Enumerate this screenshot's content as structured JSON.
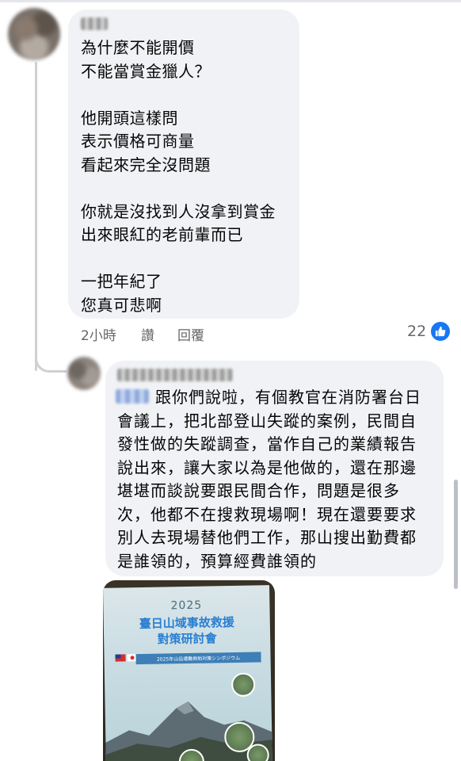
{
  "comment1": {
    "lines": [
      "為什麼不能開價",
      "不能當賞金獵人？",
      "",
      "他開頭這樣問",
      "表示價格可商量",
      "看起來完全沒問題",
      "",
      "你就是沒找到人沒拿到賞金",
      "出來眼紅的老前輩而已",
      "",
      "一把年紀了",
      "您真可悲啊"
    ],
    "time": "2小時",
    "like_label": "讚",
    "reply_label": "回覆",
    "reaction_count": "22",
    "reaction_icon": "thumbs-up-icon"
  },
  "comment2": {
    "lines": [
      "跟你們說啦，有個教官在消防署台日",
      "會議上，把北部登山失蹤的案例，民間自",
      "發性做的失蹤調查，當作自己的業績報告",
      "說出來，讓大家以為是他做的，還在那邊",
      "堪堪而談說要跟民間合作，問題是很多",
      "次，他都不在搜救現場啊！現在還要要求",
      "別人去現場替他們工作，那山搜出勤費都",
      "是誰領的，預算經費誰領的"
    ],
    "photo": {
      "year": "2025",
      "title_line1": "臺日山域事故救援",
      "title_line2": "對策研討會",
      "subtitle": "2025年山岳遭難救助対策シンポジウム"
    }
  },
  "colors": {
    "bubble": "#f0f2f5",
    "meta_text": "#65676b",
    "reaction_blue": "#1877f2"
  }
}
